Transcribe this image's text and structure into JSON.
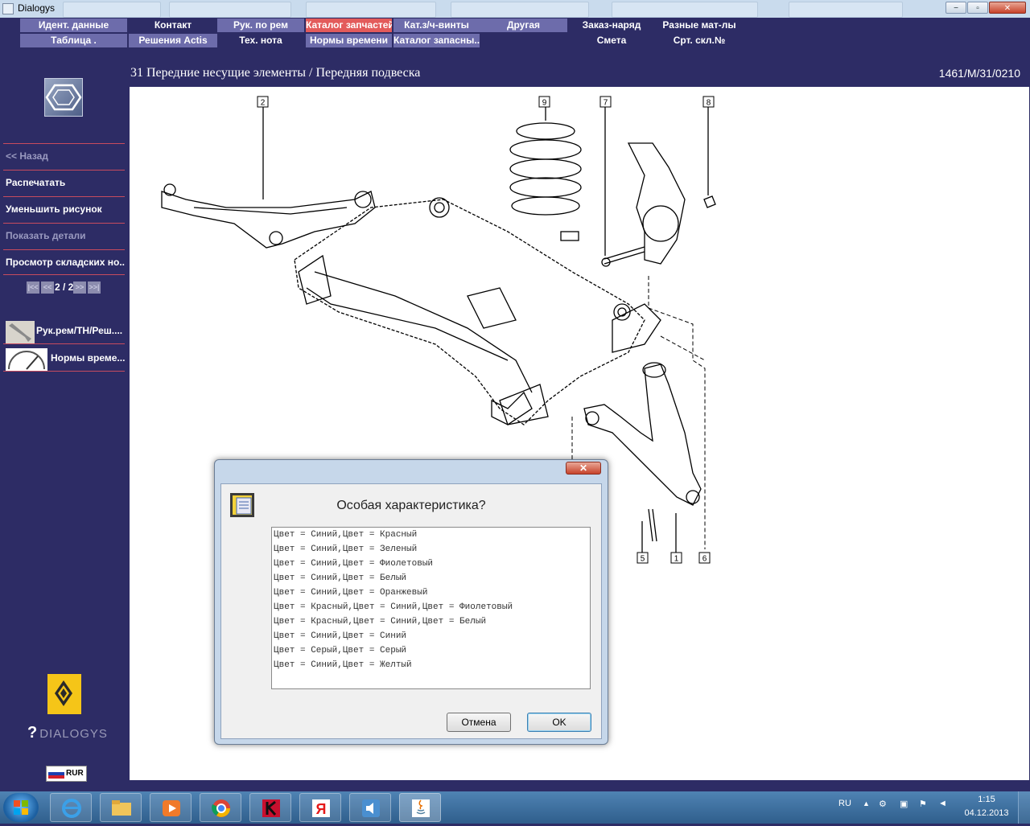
{
  "window": {
    "title": "Dialogys",
    "buttons": {
      "minimize": "−",
      "restore": "▫",
      "close": "✕"
    }
  },
  "menu": {
    "row1": [
      "Идент. данные",
      "Контакт",
      "Рук. по рем",
      "Каталог запчастей",
      "Кат.з/ч-винты",
      "Другая",
      "Заказ-наряд",
      "Разные мат-лы"
    ],
    "row2": [
      "Таблица .",
      "Решения Actis",
      "Тех. нота",
      "Нормы времени",
      "Каталог запасны...",
      "Смета",
      "Срт. скл.№"
    ],
    "active": "Каталог запчастей",
    "colors": {
      "light": "#6d6cab",
      "dark": "#2d2c65",
      "active": "#e35b5b"
    }
  },
  "sidebar": {
    "items": [
      {
        "label": "<< Назад",
        "enabled": false
      },
      {
        "label": "Распечатать",
        "enabled": true
      },
      {
        "label": "Уменьшить рисунок",
        "enabled": true
      },
      {
        "label": "Показать детали",
        "enabled": false
      },
      {
        "label": "Просмотр складских но...",
        "enabled": true
      }
    ],
    "pager": {
      "first": "|<<",
      "prev": "<<",
      "text": "2 / 2",
      "next": ">>",
      "last": ">>|"
    },
    "quick": [
      {
        "label": "Рук.рем/ТН/Реш....",
        "icon": "wrench-icon"
      },
      {
        "label": "Нормы време...",
        "icon": "gauge-icon"
      }
    ],
    "brand": "DIALOGYS",
    "currency": "RUR"
  },
  "header": {
    "title": "31 Передние несущие элементы / Передняя подвеска",
    "reference": "1461/M/31/0210"
  },
  "diagram": {
    "callouts": [
      "2",
      "9",
      "7",
      "8",
      "5",
      "1",
      "6"
    ]
  },
  "dialog": {
    "title": "Особая характеристика?",
    "options": [
      "Цвет = Синий,Цвет = Красный",
      "Цвет = Синий,Цвет = Зеленый",
      "Цвет = Синий,Цвет = Фиолетовый",
      "Цвет = Синий,Цвет = Белый",
      "Цвет = Синий,Цвет = Оранжевый",
      "Цвет = Красный,Цвет = Синий,Цвет = Фиолетовый",
      "Цвет = Красный,Цвет = Синий,Цвет = Белый",
      "Цвет = Синий,Цвет = Синий",
      "Цвет = Серый,Цвет = Серый",
      "Цвет = Синий,Цвет = Желтый"
    ],
    "cancel": "Отмена",
    "ok": "OK",
    "close": "✕"
  },
  "taskbar": {
    "apps": [
      "internet-explorer-icon",
      "file-explorer-icon",
      "media-player-icon",
      "chrome-icon",
      "kaspersky-icon",
      "yandex-icon",
      "speaker-app-icon",
      "java-icon"
    ],
    "language": "RU",
    "time": "1:15",
    "date": "04.12.2013"
  }
}
